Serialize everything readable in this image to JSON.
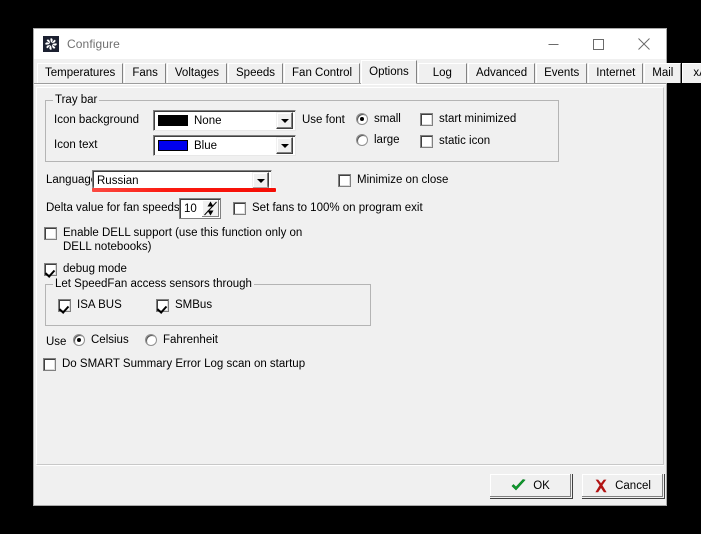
{
  "window": {
    "title": "Configure",
    "icon": "fan-icon",
    "controls": {
      "minimize": "minimize-icon",
      "maximize": "maximize-icon",
      "close": "close-icon"
    }
  },
  "tabs": [
    {
      "label": "Temperatures",
      "active": false
    },
    {
      "label": "Fans",
      "active": false
    },
    {
      "label": "Voltages",
      "active": false
    },
    {
      "label": "Speeds",
      "active": false
    },
    {
      "label": "Fan Control",
      "active": false
    },
    {
      "label": "Options",
      "active": true
    },
    {
      "label": "Log",
      "active": false
    },
    {
      "label": "Advanced",
      "active": false
    },
    {
      "label": "Events",
      "active": false
    },
    {
      "label": "Internet",
      "active": false
    },
    {
      "label": "Mail",
      "active": false
    },
    {
      "label": "xAP",
      "active": false
    }
  ],
  "options": {
    "tray_bar": {
      "title": "Tray bar",
      "icon_background": {
        "label": "Icon background",
        "value": "None",
        "swatch": "#000000"
      },
      "icon_text": {
        "label": "Icon text",
        "value": "Blue",
        "swatch": "#0000ee"
      },
      "use_font": {
        "label": "Use font",
        "small": "small",
        "large": "large",
        "selected": "small"
      },
      "start_minimized": {
        "label": "start minimized",
        "checked": false
      },
      "static_icon": {
        "label": "static icon",
        "checked": false
      }
    },
    "language": {
      "label": "Language",
      "value": "Russian"
    },
    "minimize_on_close": {
      "label": "Minimize on close",
      "checked": false
    },
    "delta_value": {
      "label": "Delta value for fan speeds",
      "value": "10"
    },
    "set_fans_100": {
      "label": "Set fans to 100% on program exit",
      "checked": false
    },
    "enable_dell": {
      "line1": "Enable DELL support (use this function only on",
      "line2": "DELL notebooks)",
      "checked": false
    },
    "debug_mode": {
      "label": "debug mode",
      "checked": true
    },
    "sensors_group": {
      "title": "Let SpeedFan access sensors through",
      "isa_bus": {
        "label": "ISA BUS",
        "checked": true
      },
      "smbus": {
        "label": "SMBus",
        "checked": true
      }
    },
    "temperature_unit": {
      "label": "Use",
      "celsius": "Celsius",
      "fahrenheit": "Fahrenheit",
      "selected": "Celsius"
    },
    "smart_scan": {
      "label": "Do SMART Summary Error Log scan on startup",
      "checked": false
    }
  },
  "footer": {
    "ok": "OK",
    "cancel": "Cancel"
  },
  "annotation": {
    "color": "#f50d05",
    "target": "language-combo"
  }
}
